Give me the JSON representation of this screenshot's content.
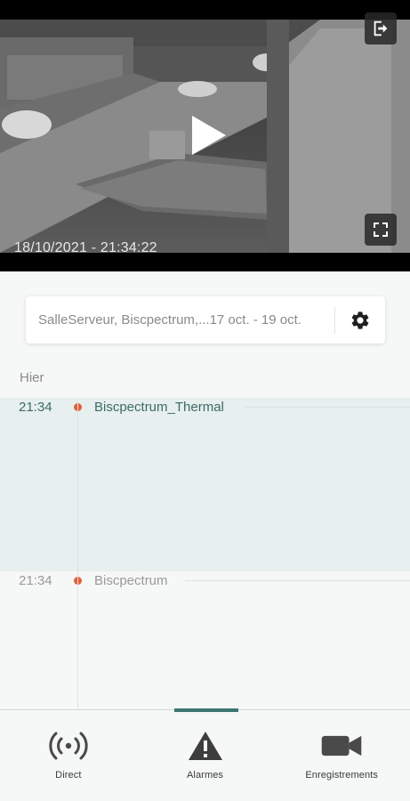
{
  "video": {
    "timestamp": "18/10/2021 - 21:34:22",
    "logout_icon": "logout-icon",
    "play_icon": "play-icon",
    "fullscreen_icon": "fullscreen-icon"
  },
  "filter": {
    "text": "SalleServeur, Biscpectrum,...17 oct. - 19 oct.",
    "settings_icon": "gear-icon"
  },
  "timeline": {
    "day_label": "Hier",
    "alarms": [
      {
        "time": "21:34",
        "name": "Biscpectrum_Thermal",
        "selected": true
      },
      {
        "time": "21:34",
        "name": "Biscpectrum",
        "selected": false
      }
    ],
    "dot_color": "#e0623a"
  },
  "nav": {
    "items": [
      {
        "label": "Direct",
        "icon": "broadcast-icon"
      },
      {
        "label": "Alarmes",
        "icon": "warning-icon",
        "active": true
      },
      {
        "label": "Enregistrements",
        "icon": "video-camera-icon"
      }
    ],
    "accent": "#3d7670"
  }
}
